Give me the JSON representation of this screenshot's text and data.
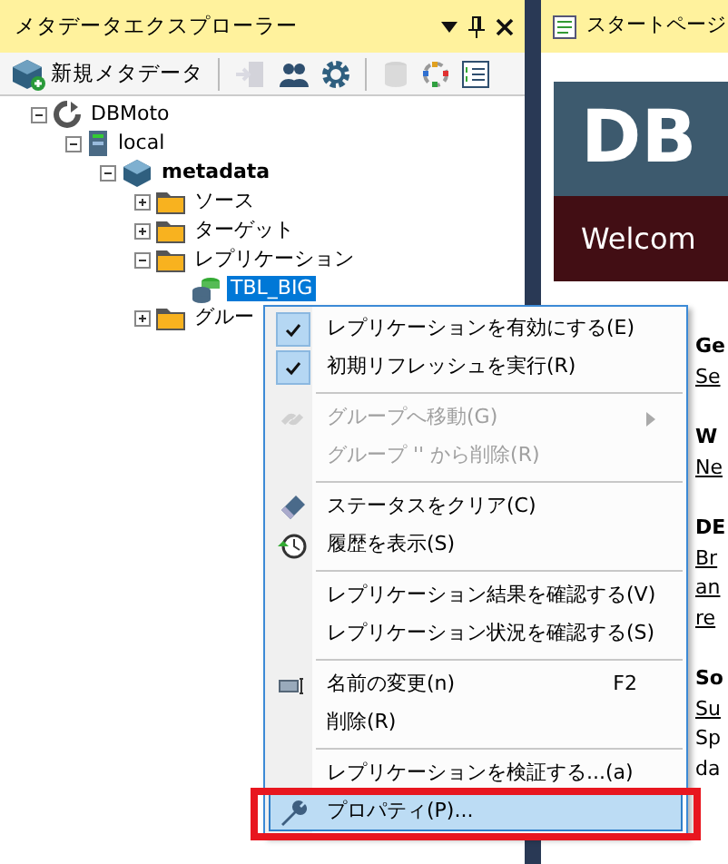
{
  "explorer": {
    "title": "メタデータエクスプローラー",
    "toolbar": [
      {
        "kind": "labeled",
        "label": "新規メタデータ",
        "disabled": false
      },
      {
        "kind": "separator"
      },
      {
        "kind": "icon",
        "disabled": true
      },
      {
        "kind": "icon",
        "disabled": false
      },
      {
        "kind": "icon",
        "disabled": false
      },
      {
        "kind": "separator"
      },
      {
        "kind": "icon",
        "disabled": true
      },
      {
        "kind": "icon",
        "disabled": false
      },
      {
        "kind": "icon",
        "disabled": false
      }
    ],
    "tree": [
      {
        "kind": "root",
        "label": "DBMoto",
        "expanded": true,
        "children": [
          {
            "kind": "server",
            "label": "local",
            "expanded": true,
            "children": [
              {
                "kind": "metadata",
                "label": "metadata",
                "bold": true,
                "expanded": true,
                "children": [
                  {
                    "kind": "folder",
                    "label": "ソース",
                    "expanded": false
                  },
                  {
                    "kind": "folder",
                    "label": "ターゲット",
                    "expanded": false
                  },
                  {
                    "kind": "folder",
                    "label": "レプリケーション",
                    "expanded": true,
                    "children": [
                      {
                        "kind": "table",
                        "label": "TBL_BIG",
                        "selected": true
                      }
                    ]
                  },
                  {
                    "kind": "folder",
                    "label": "グルー",
                    "expanded": false
                  }
                ]
              }
            ]
          }
        ]
      }
    ]
  },
  "start_page": {
    "tab": "スタートページ",
    "banner": {
      "title": "DB",
      "subtitle": "Welcom"
    },
    "sections": [
      {
        "heading": "Ge",
        "lines": [
          {
            "kind": "link",
            "text": "Se"
          }
        ]
      },
      {
        "heading": "W",
        "lines": [
          {
            "kind": "link",
            "text": "Ne"
          }
        ]
      },
      {
        "heading": "DE",
        "lines": [
          {
            "kind": "link",
            "text": "Br"
          },
          {
            "kind": "link",
            "text": "an"
          },
          {
            "kind": "link",
            "text": "re"
          }
        ]
      },
      {
        "heading": "So",
        "lines": [
          {
            "kind": "link",
            "text": "Su"
          },
          {
            "kind": "text",
            "text": "Sp"
          },
          {
            "kind": "text",
            "text": "da"
          }
        ]
      }
    ]
  },
  "context_menu": [
    {
      "kind": "check",
      "label": "レプリケーションを有効にする(E)",
      "checked": true
    },
    {
      "kind": "check",
      "label": "初期リフレッシュを実行(R)",
      "checked": true
    },
    {
      "kind": "separator"
    },
    {
      "kind": "item",
      "label": "グループへ移動(G)",
      "disabled": true,
      "submenu": true
    },
    {
      "kind": "item",
      "label": "グループ '' から削除(R)",
      "disabled": true
    },
    {
      "kind": "separator"
    },
    {
      "kind": "item",
      "label": "ステータスをクリア(C)"
    },
    {
      "kind": "item",
      "label": "履歴を表示(S)"
    },
    {
      "kind": "separator"
    },
    {
      "kind": "item",
      "label": "レプリケーション結果を確認する(V)"
    },
    {
      "kind": "item",
      "label": "レプリケーション状況を確認する(S)"
    },
    {
      "kind": "separator"
    },
    {
      "kind": "item",
      "label": "名前の変更(n)",
      "shortcut": "F2"
    },
    {
      "kind": "item",
      "label": "削除(R)"
    },
    {
      "kind": "separator"
    },
    {
      "kind": "item",
      "label": "レプリケーションを検証する...(a)"
    },
    {
      "kind": "item",
      "label": "プロパティ(P)...",
      "highlighted": true
    }
  ]
}
